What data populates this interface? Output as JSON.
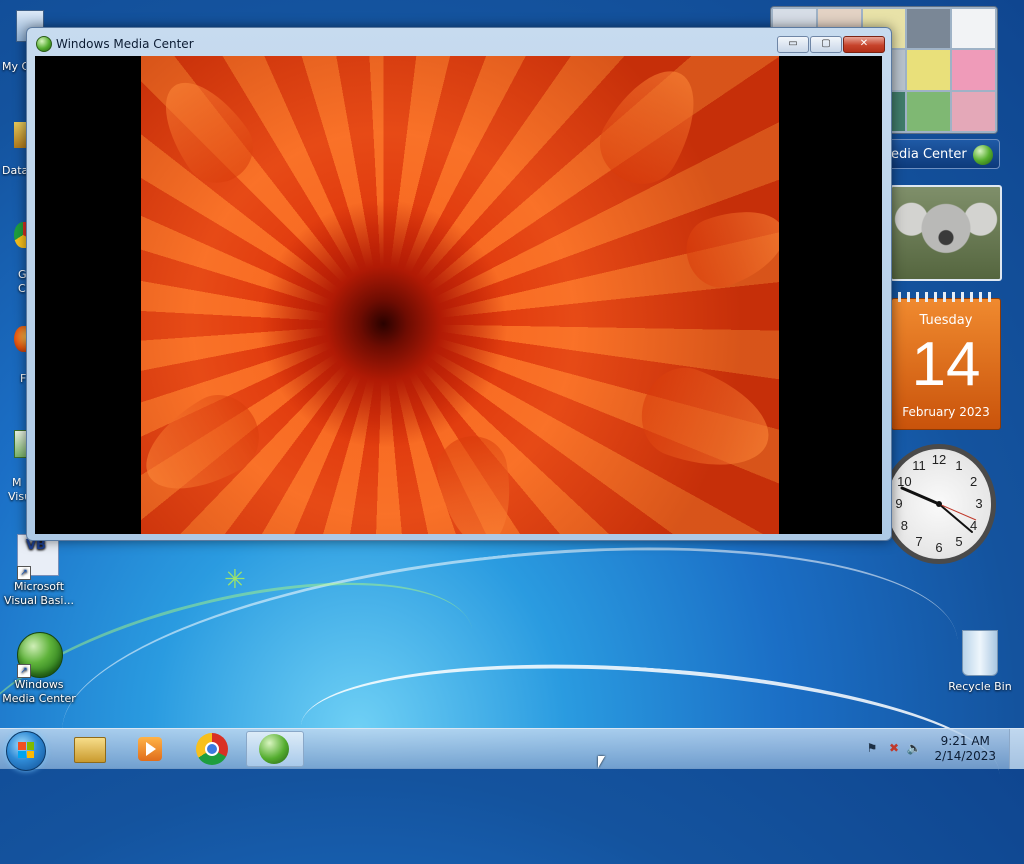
{
  "window": {
    "title": "Windows Media Center",
    "controls": {
      "minimize": "▭",
      "maximize": "▢",
      "close": "✕"
    }
  },
  "desktop_icons": {
    "my_computer_partial": "My C",
    "data_partial": "Data",
    "chrome_partial_1": "G",
    "chrome_partial_2": "C",
    "firefox_partial": "F",
    "ms_partial_1": "M",
    "ms_partial_2": "Visu",
    "vb_line1": "Microsoft",
    "vb_line2": "Visual Basi...",
    "wmc_line1": "Windows",
    "wmc_line2": "Media Center",
    "recycle_bin": "Recycle Bin"
  },
  "gadgets": {
    "media_center_label": "edia Center",
    "calendar": {
      "day": "Tuesday",
      "date": "14",
      "month": "February 2023"
    },
    "clock_numbers": [
      "12",
      "1",
      "2",
      "3",
      "4",
      "5",
      "6",
      "7",
      "8",
      "9",
      "10",
      "11"
    ]
  },
  "taskbar": {
    "time": "9:21 AM",
    "date": "2/14/2023",
    "buttons": [
      "Windows Explorer",
      "Windows Media Player",
      "Google Chrome",
      "Windows Media Center"
    ]
  },
  "colors": {
    "calendar_orange": "#e06d1b",
    "window_frame": "#bcd3ea",
    "close_red": "#c7442c"
  }
}
